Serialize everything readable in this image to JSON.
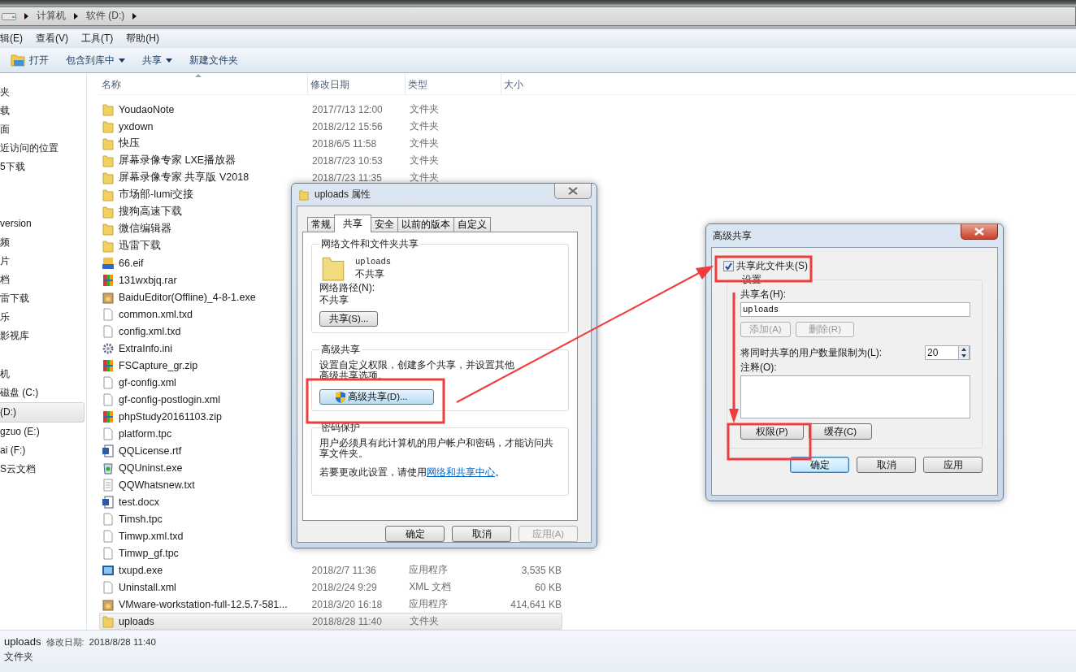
{
  "address_bar": {
    "crumbs": [
      "计算机",
      "软件 (D:)"
    ]
  },
  "menu": [
    "辑(E)",
    "查看(V)",
    "工具(T)",
    "帮助(H)"
  ],
  "toolbar": [
    {
      "label": "打开",
      "kind": "open"
    },
    {
      "label": "包含到库中",
      "kind": "dropdown"
    },
    {
      "label": "共享",
      "kind": "dropdown"
    },
    {
      "label": "新建文件夹",
      "kind": "plain"
    }
  ],
  "sidebar": {
    "groups": [
      {
        "items": [
          {
            "label": "夹",
            "selected": false
          },
          {
            "label": "载",
            "selected": false
          },
          {
            "label": "面",
            "selected": false
          },
          {
            "label": "近访问的位置",
            "selected": false
          },
          {
            "label": "5下载",
            "selected": false
          }
        ]
      },
      {
        "items": [
          {
            "label": "version",
            "selected": false
          },
          {
            "label": "频",
            "selected": false
          },
          {
            "label": "片",
            "selected": false
          },
          {
            "label": "档",
            "selected": false
          },
          {
            "label": "雷下载",
            "selected": false
          },
          {
            "label": "乐",
            "selected": false
          },
          {
            "label": "影视库",
            "selected": false
          }
        ]
      },
      {
        "items": [
          {
            "label": "机",
            "selected": false
          },
          {
            "label": "磁盘 (C:)",
            "selected": false
          },
          {
            "label": "(D:)",
            "selected": true
          },
          {
            "label": "gzuo (E:)",
            "selected": false
          },
          {
            "label": "ai (F:)",
            "selected": false
          },
          {
            "label": "S云文档",
            "selected": false
          }
        ]
      }
    ]
  },
  "file_list": {
    "columns": [
      "名称",
      "修改日期",
      "类型",
      "大小"
    ],
    "rows": [
      {
        "name": "YoudaoNote",
        "kind": "folder",
        "date": "2017/7/13 12:00",
        "type": "文件夹",
        "selected": false
      },
      {
        "name": "yxdown",
        "kind": "folder",
        "date": "2018/2/12 15:56",
        "type": "文件夹",
        "selected": false
      },
      {
        "name": "快压",
        "kind": "folder",
        "date": "2018/6/5 11:58",
        "type": "文件夹",
        "selected": false
      },
      {
        "name": "屏幕录像专家 LXE播放器",
        "kind": "folder",
        "date": "2018/7/23 10:53",
        "type": "文件夹",
        "selected": false
      },
      {
        "name": "屏幕录像专家 共享版 V2018",
        "kind": "folder",
        "date": "2018/7/23 11:35",
        "type": "文件夹",
        "selected": false
      },
      {
        "name": "市场部-lumi交接",
        "kind": "folder",
        "selected": false
      },
      {
        "name": "搜狗高速下载",
        "kind": "folder",
        "selected": false
      },
      {
        "name": "微信编辑器",
        "kind": "folder",
        "selected": false
      },
      {
        "name": "迅雷下载",
        "kind": "folder",
        "selected": false
      },
      {
        "name": "66.eif",
        "kind": "eif",
        "selected": false
      },
      {
        "name": "131wxbjq.rar",
        "kind": "archive",
        "selected": false
      },
      {
        "name": "BaiduEditor(Offline)_4-8-1.exe",
        "kind": "installer",
        "selected": false
      },
      {
        "name": "common.xml.txd",
        "kind": "file",
        "selected": false
      },
      {
        "name": "config.xml.txd",
        "kind": "file",
        "selected": false
      },
      {
        "name": "ExtraInfo.ini",
        "kind": "settings",
        "selected": false
      },
      {
        "name": "FSCapture_gr.zip",
        "kind": "archive",
        "selected": false
      },
      {
        "name": "gf-config.xml",
        "kind": "file",
        "selected": false
      },
      {
        "name": "gf-config-postlogin.xml",
        "kind": "file",
        "selected": false
      },
      {
        "name": "phpStudy20161103.zip",
        "kind": "archive",
        "selected": false
      },
      {
        "name": "platform.tpc",
        "kind": "file",
        "selected": false
      },
      {
        "name": "QQLicense.rtf",
        "kind": "word",
        "selected": false
      },
      {
        "name": "QQUninst.exe",
        "kind": "bin",
        "selected": false
      },
      {
        "name": "QQWhatsnew.txt",
        "kind": "text",
        "selected": false
      },
      {
        "name": "test.docx",
        "kind": "word",
        "selected": false
      },
      {
        "name": "Timsh.tpc",
        "kind": "file",
        "selected": false
      },
      {
        "name": "Timwp.xml.txd",
        "kind": "file",
        "selected": false
      },
      {
        "name": "Timwp_gf.tpc",
        "kind": "file",
        "selected": false
      },
      {
        "name": "txupd.exe",
        "kind": "app",
        "date": "2018/2/7 11:36",
        "type": "应用程序",
        "size": "3,535 KB",
        "selected": false
      },
      {
        "name": "Uninstall.xml",
        "kind": "file",
        "date": "2018/2/24 9:29",
        "type": "XML 文档",
        "size": "60 KB",
        "selected": false
      },
      {
        "name": "VMware-workstation-full-12.5.7-581...",
        "kind": "installer",
        "date": "2018/3/20 16:18",
        "type": "应用程序",
        "size": "414,641 KB",
        "selected": false
      },
      {
        "name": "uploads",
        "kind": "folder",
        "date": "2018/8/28 11:40",
        "type": "文件夹",
        "selected": true
      }
    ]
  },
  "status_bar": {
    "name": "uploads",
    "date_label": "修改日期:",
    "date": "2018/8/28 11:40",
    "type": "文件夹"
  },
  "properties_dialog": {
    "title": "uploads 属性",
    "tabs": [
      {
        "label": "常规",
        "selected": false
      },
      {
        "label": "共享",
        "selected": true
      },
      {
        "label": "安全",
        "selected": false
      },
      {
        "label": "以前的版本",
        "selected": false
      },
      {
        "label": "自定义",
        "selected": false
      }
    ],
    "network_group": {
      "title": "网络文件和文件夹共享",
      "folder_name": "uploads",
      "share_status": "不共享",
      "path_label": "网络路径(N):",
      "path_value": "不共享",
      "share_button": "共享(S)..."
    },
    "advanced_group": {
      "title": "高级共享",
      "description": "设置自定义权限，创建多个共享，并设置其他高级共享选项。",
      "button": "高级共享(D)..."
    },
    "password_group": {
      "title": "密码保护",
      "description": "用户必须具有此计算机的用户帐户和密码，才能访问共享文件夹。",
      "note_before": "若要更改此设置，请使用",
      "link": "网络和共享中心",
      "note_after": "。"
    },
    "buttons": [
      {
        "label": "确定",
        "disabled": false
      },
      {
        "label": "取消",
        "disabled": false
      },
      {
        "label": "应用(A)",
        "disabled": true
      }
    ]
  },
  "advanced_dialog": {
    "title": "高级共享",
    "share_checkbox": {
      "label": "共享此文件夹(S)",
      "checked": true
    },
    "settings": {
      "title": "设置",
      "share_name_label": "共享名(H):",
      "share_name": "uploads",
      "add_button": {
        "label": "添加(A)",
        "disabled": true
      },
      "remove_button": {
        "label": "删除(R)",
        "disabled": true
      },
      "limit_label": "将同时共享的用户数量限制为(L):",
      "limit_value": "20",
      "comment_label": "注释(O):",
      "permissions_button": "权限(P)",
      "cache_button": "缓存(C)"
    },
    "buttons": [
      {
        "label": "确定",
        "default": true
      },
      {
        "label": "取消",
        "default": false
      },
      {
        "label": "应用",
        "default": false
      }
    ]
  }
}
